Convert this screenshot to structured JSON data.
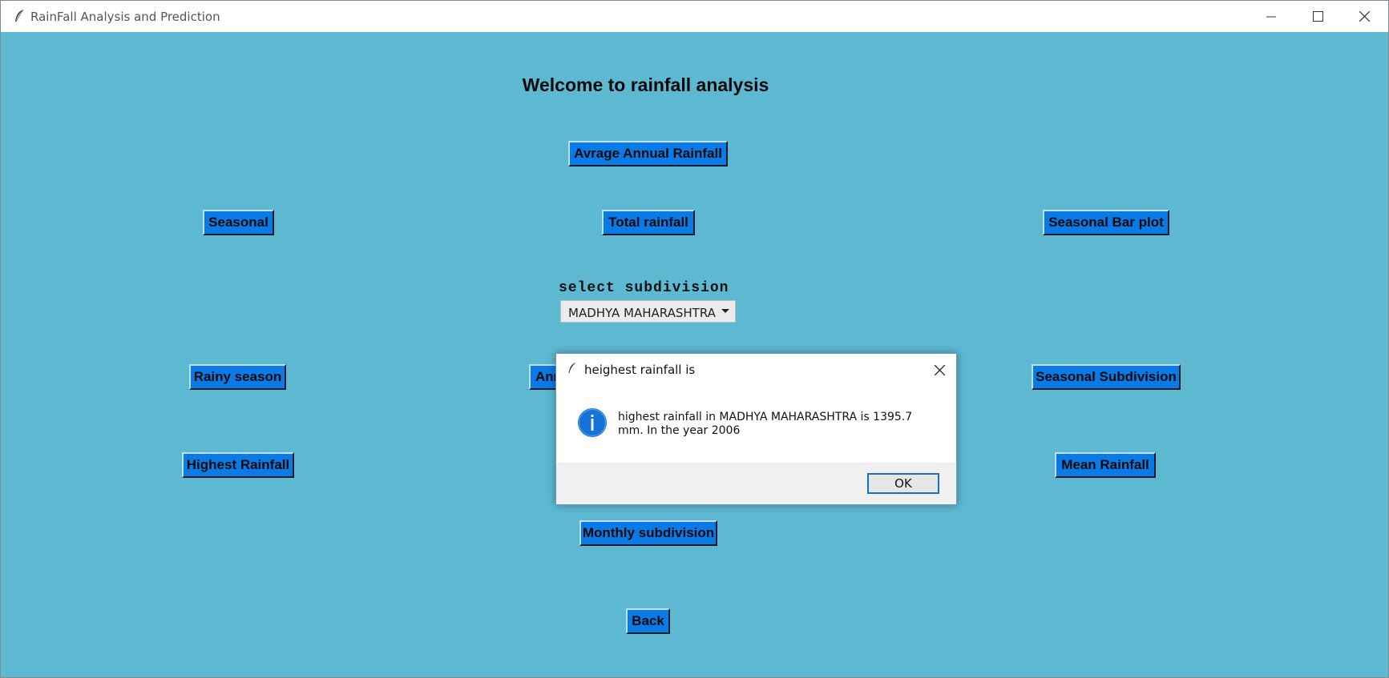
{
  "window": {
    "title": "RainFall Analysis and Prediction"
  },
  "heading": "Welcome to rainfall analysis",
  "buttons": {
    "avg_annual": "Avrage Annual Rainfall",
    "seasonal": "Seasonal",
    "total": "Total rainfall",
    "seasonal_bar": "Seasonal Bar plot",
    "rainy_season": "Rainy season",
    "annual_partial": "Ann",
    "seasonal_subdivision": "Seasonal Subdivision",
    "highest": "Highest Rainfall",
    "mean": "Mean Rainfall",
    "monthly_subdivision": "Monthly subdivision",
    "back": "Back"
  },
  "subdivision": {
    "label": "select subdivision",
    "selected": "MADHYA MAHARASHTRA"
  },
  "dialog": {
    "title": "heighest rainfall is",
    "message": "highest rainfall in MADHYA MAHARASHTRA is 1395.7 mm. In the year 2006",
    "ok": "OK"
  },
  "icons": {
    "app": "feather-icon",
    "minimize": "minimize-icon",
    "maximize": "maximize-icon",
    "close": "close-icon",
    "dropdown": "chevron-down-icon",
    "info": "info-icon"
  },
  "colors": {
    "background": "#5db8d1",
    "button": "#0a7ae6",
    "info_icon": "#1473d6"
  }
}
